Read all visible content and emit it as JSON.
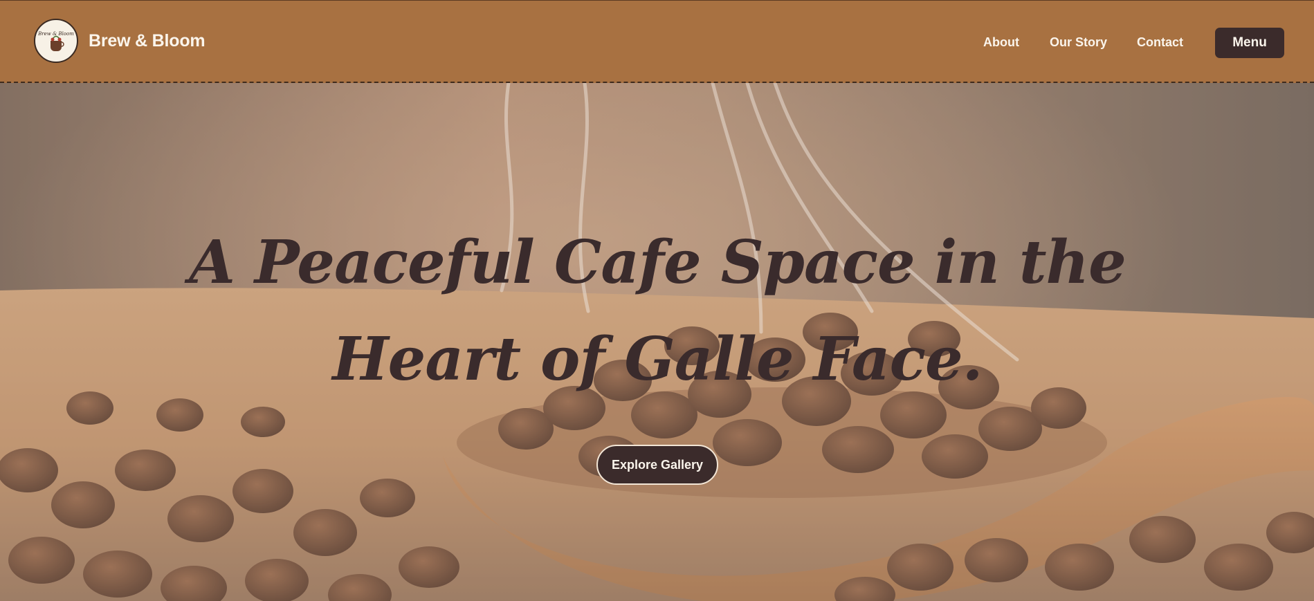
{
  "header": {
    "logo_icon": "cafe-logo-icon",
    "logo_text": "Brew & Bloom",
    "brand": "Brew & Bloom",
    "nav": [
      {
        "label": "About"
      },
      {
        "label": "Our Story"
      },
      {
        "label": "Contact"
      }
    ],
    "menu_button": "Menu"
  },
  "hero": {
    "background": "coffee-beans-in-wooden-spoon-photo",
    "title": "A Peaceful Cafe Space in the Heart of Galle Face.",
    "cta_label": "Explore Gallery"
  },
  "colors": {
    "header_bg": "#a87141",
    "dark": "#3b2b2b",
    "light_text": "#fbf5ec",
    "title_text": "#3a2b2c"
  }
}
